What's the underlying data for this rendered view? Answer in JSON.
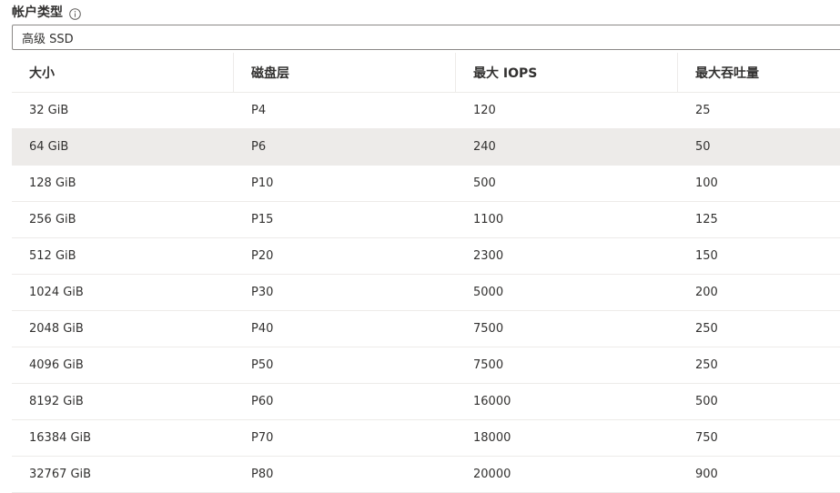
{
  "field": {
    "label": "帐户类型",
    "info_icon": "info-icon",
    "selected_value": "高级 SSD"
  },
  "table": {
    "headers": [
      "大小",
      "磁盘层",
      "最大 IOPS",
      "最大吞吐量"
    ],
    "rows": [
      {
        "size": "32 GiB",
        "tier": "P4",
        "iops": "120",
        "throughput": "25"
      },
      {
        "size": "64 GiB",
        "tier": "P6",
        "iops": "240",
        "throughput": "50",
        "selected": true
      },
      {
        "size": "128 GiB",
        "tier": "P10",
        "iops": "500",
        "throughput": "100"
      },
      {
        "size": "256 GiB",
        "tier": "P15",
        "iops": "1100",
        "throughput": "125"
      },
      {
        "size": "512 GiB",
        "tier": "P20",
        "iops": "2300",
        "throughput": "150"
      },
      {
        "size": "1024 GiB",
        "tier": "P30",
        "iops": "5000",
        "throughput": "200"
      },
      {
        "size": "2048 GiB",
        "tier": "P40",
        "iops": "7500",
        "throughput": "250"
      },
      {
        "size": "4096 GiB",
        "tier": "P50",
        "iops": "7500",
        "throughput": "250"
      },
      {
        "size": "8192 GiB",
        "tier": "P60",
        "iops": "16000",
        "throughput": "500"
      },
      {
        "size": "16384 GiB",
        "tier": "P70",
        "iops": "18000",
        "throughput": "750"
      },
      {
        "size": "32767 GiB",
        "tier": "P80",
        "iops": "20000",
        "throughput": "900"
      }
    ]
  },
  "colors": {
    "selected_row_bg": "#edebe9",
    "border": "#8a8886"
  }
}
